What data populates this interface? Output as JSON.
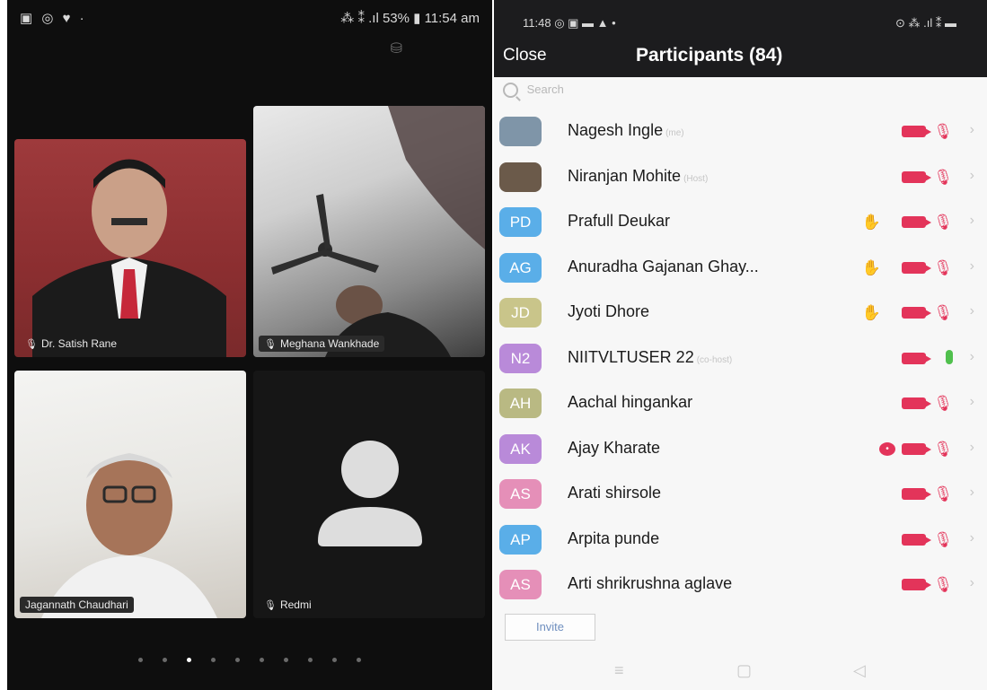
{
  "left_status": {
    "left_icons": "▣ ◎ ♥ ·",
    "right": "⁂ ⁑ .ıl 53% ▮ 11:54 am"
  },
  "top_icon": "⛁",
  "tiles": [
    {
      "name": "Dr. Satish Rane"
    },
    {
      "name": "Meghana Wankhade"
    },
    {
      "name": "Jagannath Chaudhari"
    },
    {
      "name": "Redmi"
    }
  ],
  "page_dots": {
    "count": 10,
    "active_index": 2
  },
  "right_status": {
    "time": "11:48",
    "left_icons": "◎ ▣ ▬ ▲ •",
    "right_icons": "⊙ ⁂ .ıl ⁑ ▬"
  },
  "header": {
    "close_label": "Close",
    "title": "Participants (84)"
  },
  "search": {
    "placeholder": "Search"
  },
  "participants": [
    {
      "name": "Nagesh Ingle",
      "tag": "(me)",
      "avatar": "",
      "avatar_color": "#7f95a8",
      "hand": false,
      "chat": false,
      "mic_on": false
    },
    {
      "name": "Niranjan Mohite",
      "tag": "(Host)",
      "avatar": "",
      "avatar_color": "#6b5a4a",
      "hand": false,
      "chat": false,
      "mic_on": false
    },
    {
      "name": "Prafull Deukar",
      "tag": "",
      "avatar": "PD",
      "avatar_color": "#5aaee8",
      "hand": true,
      "chat": false,
      "mic_on": false
    },
    {
      "name": "Anuradha Gajanan Ghay...",
      "tag": "",
      "avatar": "AG",
      "avatar_color": "#5aaee8",
      "hand": true,
      "chat": false,
      "mic_on": false
    },
    {
      "name": "Jyoti Dhore",
      "tag": "",
      "avatar": "JD",
      "avatar_color": "#c9c58a",
      "hand": true,
      "chat": false,
      "mic_on": false
    },
    {
      "name": "NIITVLTUSER 22",
      "tag": "(co-host)",
      "avatar": "N2",
      "avatar_color": "#b98ad9",
      "hand": false,
      "chat": false,
      "mic_on": true
    },
    {
      "name": "Aachal hingankar",
      "tag": "",
      "avatar": "AH",
      "avatar_color": "#b9b983",
      "hand": false,
      "chat": false,
      "mic_on": false
    },
    {
      "name": "Ajay Kharate",
      "tag": "",
      "avatar": "AK",
      "avatar_color": "#b98ad9",
      "hand": false,
      "chat": true,
      "mic_on": false
    },
    {
      "name": "Arati shirsole",
      "tag": "",
      "avatar": "AS",
      "avatar_color": "#e58fb8",
      "hand": false,
      "chat": false,
      "mic_on": false
    },
    {
      "name": "Arpita punde",
      "tag": "",
      "avatar": "AP",
      "avatar_color": "#5aaee8",
      "hand": false,
      "chat": false,
      "mic_on": false
    },
    {
      "name": "Arti shrikrushna aglave",
      "tag": "",
      "avatar": "AS",
      "avatar_color": "#e58fb8",
      "hand": false,
      "chat": false,
      "mic_on": false
    }
  ],
  "invite_label": "Invite",
  "navbar": {
    "recents": "≡",
    "home": "▢",
    "back": "◁"
  },
  "colors": {
    "header_bg": "#1c1c1e",
    "muted_red": "#e3345a",
    "mic_green": "#50c04d",
    "list_bg": "#f7f7f7"
  }
}
